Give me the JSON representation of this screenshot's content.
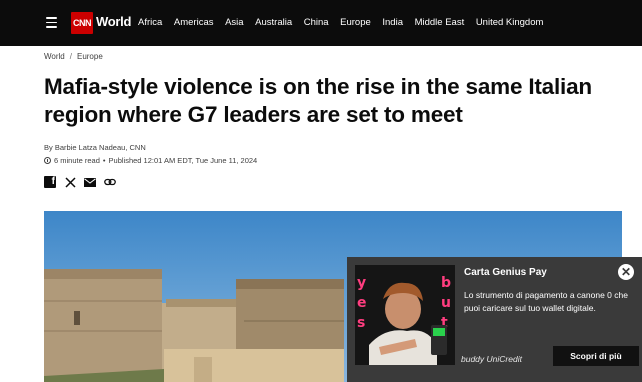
{
  "nav": {
    "logo_text": "CNN",
    "section": "World",
    "links": [
      "Africa",
      "Americas",
      "Asia",
      "Australia",
      "China",
      "Europe",
      "India",
      "Middle East",
      "United Kingdom"
    ]
  },
  "breadcrumb": [
    "World",
    "Europe"
  ],
  "breadcrumb_separator": "/",
  "article": {
    "headline": "Mafia-style violence is on the rise in the same Italian region where G7 leaders are set to meet",
    "byline_prefix": "By",
    "author": "Barbie Latza Nadeau, CNN",
    "read_time": "6 minute read",
    "published": "Published 12:01 AM EDT, Tue June 11, 2024"
  },
  "share_icons": [
    "facebook-icon",
    "x-icon",
    "email-icon",
    "link-icon"
  ],
  "ad": {
    "title": "Carta Genius Pay",
    "body": "Lo strumento di pagamento a canone 0 che puoi caricare sul tuo wallet digitale.",
    "brand": "buddy UniCredit",
    "cta": "Scopri di più",
    "close_symbol": "✕"
  },
  "colors": {
    "nav_bg": "#0c0c0c",
    "brand_red": "#cc0000",
    "ad_bg": "#3a3a3a"
  }
}
